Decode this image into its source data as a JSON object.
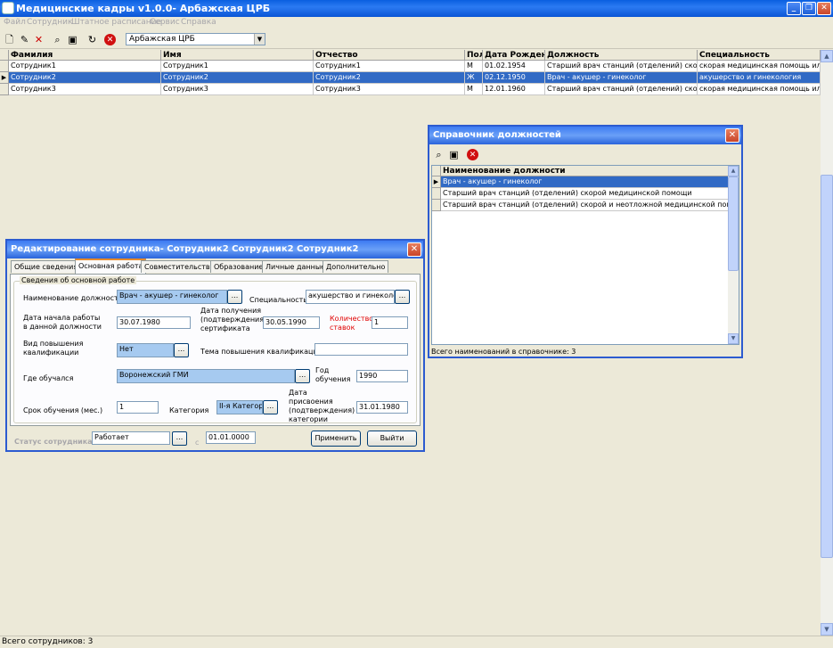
{
  "app": {
    "title": "Медицинские кадры v1.0.0- Арбажская ЦРБ"
  },
  "menu": [
    "Файл",
    "Сотрудник",
    "Штатное расписание",
    "Сервис",
    "Справка"
  ],
  "toolbar": {
    "org_combo": "Арбажская ЦРБ"
  },
  "grid": {
    "columns": [
      "Фамилия",
      "Имя",
      "Отчество",
      "Пол",
      "Дата Рождения",
      "Должность",
      "Специальность"
    ],
    "rows": [
      [
        "Сотрудник1",
        "Сотрудник1",
        "Сотрудник1",
        "М",
        "01.02.1954",
        "Старший врач станций (отделений) скорой и н",
        "скорая медицинская помощь или"
      ],
      [
        "Сотрудник2",
        "Сотрудник2",
        "Сотрудник2",
        "Ж",
        "02.12.1950",
        "Врач - акушер - гинеколог",
        "акушерство и гинекология"
      ],
      [
        "Сотрудник3",
        "Сотрудник3",
        "Сотрудник3",
        "М",
        "12.01.1960",
        "Старший врач станций (отделений) скорой ме",
        "скорая медицинская помощь или"
      ]
    ],
    "selected_row": 1
  },
  "status": "Всего сотрудников: 3",
  "posts_dialog": {
    "title": "Справочник должностей",
    "column": "Наименование должности",
    "items": [
      "Врач - акушер - гинеколог",
      "Старший врач станций (отделений) скорой медицинской помощи",
      "Старший врач станций (отделений) скорой и неотложной медицинской помощи"
    ],
    "footer": "Всего наименований в справочнике: 3"
  },
  "edit_dialog": {
    "title": "Редактирование сотрудника- Сотрудник2 Сотрудник2 Сотрудник2",
    "tabs": [
      "Общие сведения",
      "Основная работа",
      "Совместительство",
      "Образование",
      "Личные данные",
      "Дополнительно"
    ],
    "active_tab": 1,
    "group_title": "Сведения об основной работе",
    "labels": {
      "post": "Наименование должности",
      "specialty": "Специальность",
      "start_date": "Дата начала работы в данной должности",
      "cert_date": "Дата получения (подтверждения) сертификата",
      "rates": "Количество ставок",
      "qual_type": "Вид повышения квалификации",
      "qual_topic": "Тема повышения квалификации",
      "studied": "Где обучался",
      "study_year": "Год обучения",
      "study_term": "Срок обучения (мес.)",
      "category": "Категория",
      "category_date": "Дата присвоения (подтверждения) категории",
      "status": "Статус сотрудника",
      "since": "с"
    },
    "values": {
      "post": "Врач - акушер - гинеколог",
      "specialty": "акушерство и  гинеколог",
      "start_date": "30.07.1980",
      "cert_date": "30.05.1990",
      "rates": "1",
      "qual_type": "Нет",
      "qual_topic": "",
      "studied": "Воронежский ГМИ",
      "study_year": "1990",
      "study_term": "1",
      "category": "II-я Категори",
      "category_date": "31.01.1980",
      "status": "Работает",
      "since": "01.01.0000"
    },
    "buttons": {
      "apply": "Применить",
      "exit": "Выйти",
      "dots": "..."
    }
  },
  "colors": {
    "selection": "#316ac5",
    "title_bar": "#0a5fe0",
    "required_label": "#e00000"
  }
}
